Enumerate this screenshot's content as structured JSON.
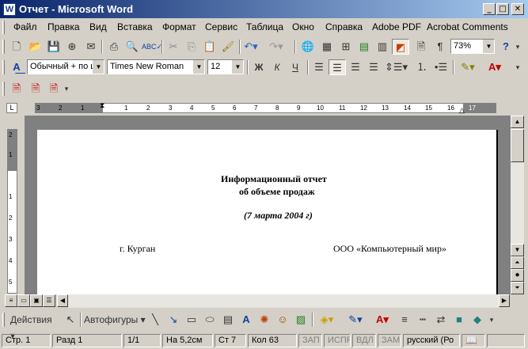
{
  "window": {
    "title": "Отчет - Microsoft Word",
    "app_icon": "W"
  },
  "menu": [
    "Файл",
    "Правка",
    "Вид",
    "Вставка",
    "Формат",
    "Сервис",
    "Таблица",
    "Окно",
    "Справка",
    "Adobe PDF",
    "Acrobat Comments"
  ],
  "standard_toolbar": {
    "zoom": "73%",
    "help": "?"
  },
  "format_toolbar": {
    "style": "Обычный + по ц",
    "font": "Times New Roman",
    "size": "12",
    "bold": "Ж",
    "italic": "К",
    "underline": "Ч"
  },
  "ruler": {
    "h_ticks": [
      "3",
      "2",
      "1",
      "1",
      "2",
      "3",
      "4",
      "5",
      "6",
      "7",
      "8",
      "9",
      "10",
      "11",
      "12",
      "13",
      "14",
      "15",
      "16",
      "17"
    ],
    "v_ticks": [
      "2",
      "1",
      "1",
      "2",
      "3",
      "4",
      "5"
    ]
  },
  "document": {
    "title_line1": "Информационный отчет",
    "title_line2": "об объеме продаж",
    "date_line": "(7 марта 2004 г)",
    "city": "г. Курган",
    "company": "ООО «Компьютерный мир»"
  },
  "draw_toolbar": {
    "actions": "Действия",
    "autoshapes": "Автофигуры"
  },
  "statusbar": {
    "page": "Стр. 1",
    "section": "Разд 1",
    "pages": "1/1",
    "at": "На 5,2см",
    "line": "Ст 7",
    "col": "Кол 63",
    "rec": "ЗАП",
    "trk": "ИСПР",
    "ext": "ВДЛ",
    "ovr": "ЗАМ",
    "lang": "русский (Ро"
  }
}
